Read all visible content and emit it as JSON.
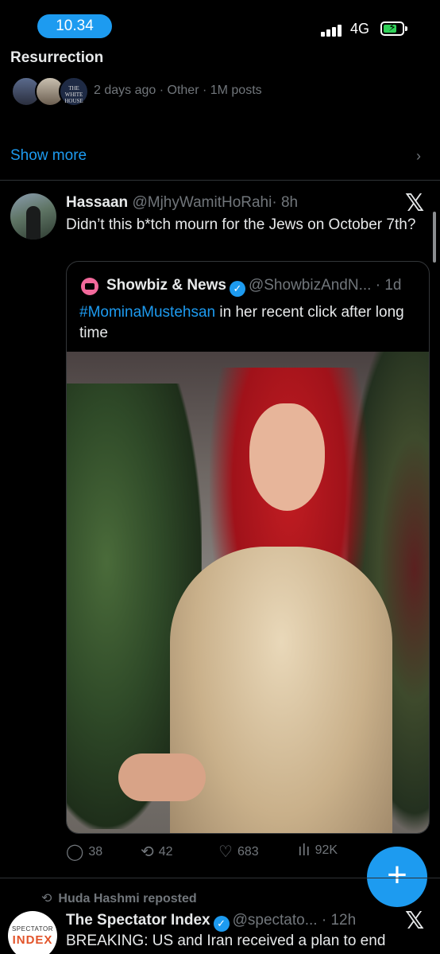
{
  "status_bar": {
    "time": "10.34",
    "network": "4G"
  },
  "trend": {
    "title": "Resurrection",
    "avatar_text": "THE WHITE HOUSE",
    "meta": "2 days ago · Other · 1M posts"
  },
  "show_more": "Show more",
  "tweet": {
    "name": "Hassaan",
    "handle": "@MjhyWamitHoRahi",
    "time": "· 8h",
    "text": "Didn’t this b*tch mourn for the Jews on October 7th?",
    "quote": {
      "name": "Showbiz & News",
      "handle": "@ShowbizAndN...",
      "time": "· 1d",
      "hashtag": "#MominaMustehsan",
      "text": " in her recent click after long time"
    },
    "actions": {
      "replies": "38",
      "reposts": "42",
      "likes": "683",
      "views": "92K"
    }
  },
  "next_tweet": {
    "repost_label": "Huda Hashmi reposted",
    "avatar_line1": "SPECTATOR",
    "avatar_line2": "INDEX",
    "name": "The Spectator Index",
    "handle": "@spectato...",
    "time": "· 12h",
    "text": "BREAKING: US and Iran received a plan to end"
  },
  "fab_label": "+",
  "colors": {
    "accent": "#1d9bf0",
    "background": "#000000",
    "muted": "#71767b",
    "text": "#e7e9ea"
  },
  "icons": [
    "x-logo-icon",
    "reply-icon",
    "repost-icon",
    "like-icon",
    "views-icon",
    "chevron-right-icon",
    "verified-icon",
    "compose-plus-icon",
    "battery-icon",
    "signal-icon"
  ]
}
